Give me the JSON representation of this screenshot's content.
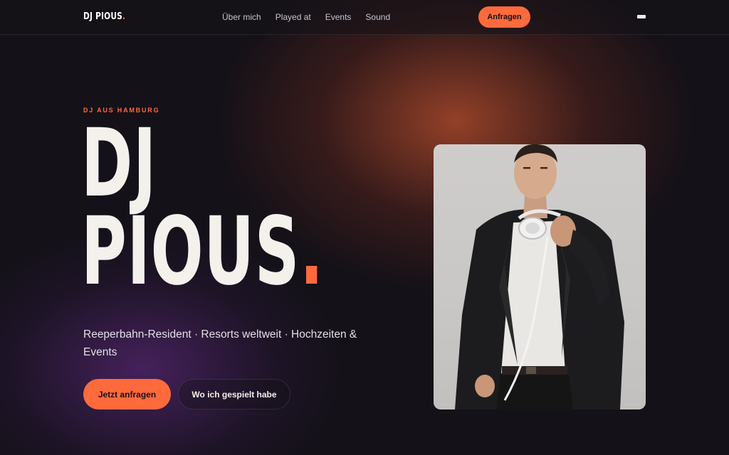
{
  "nav": {
    "logo_text": "DJ PIOUS",
    "logo_dot": ".",
    "links": [
      "Über mich",
      "Played at",
      "Events",
      "Sound"
    ],
    "cta_label": "Anfragen"
  },
  "hero": {
    "eyebrow": "DJ AUS HAMBURG",
    "title_line1": "DJ",
    "title_line2": "PIOUS",
    "title_dot": ".",
    "subline": "Reeperbahn-Resident · Resorts weltweit · Hochzeiten & Events",
    "primary_button": "Jetzt anfragen",
    "secondary_button": "Wo ich gespielt habe"
  },
  "colors": {
    "accent": "#ff6a3d",
    "background": "#141118",
    "text": "#f2efe9"
  },
  "icons": {
    "menu": "menu-icon"
  }
}
